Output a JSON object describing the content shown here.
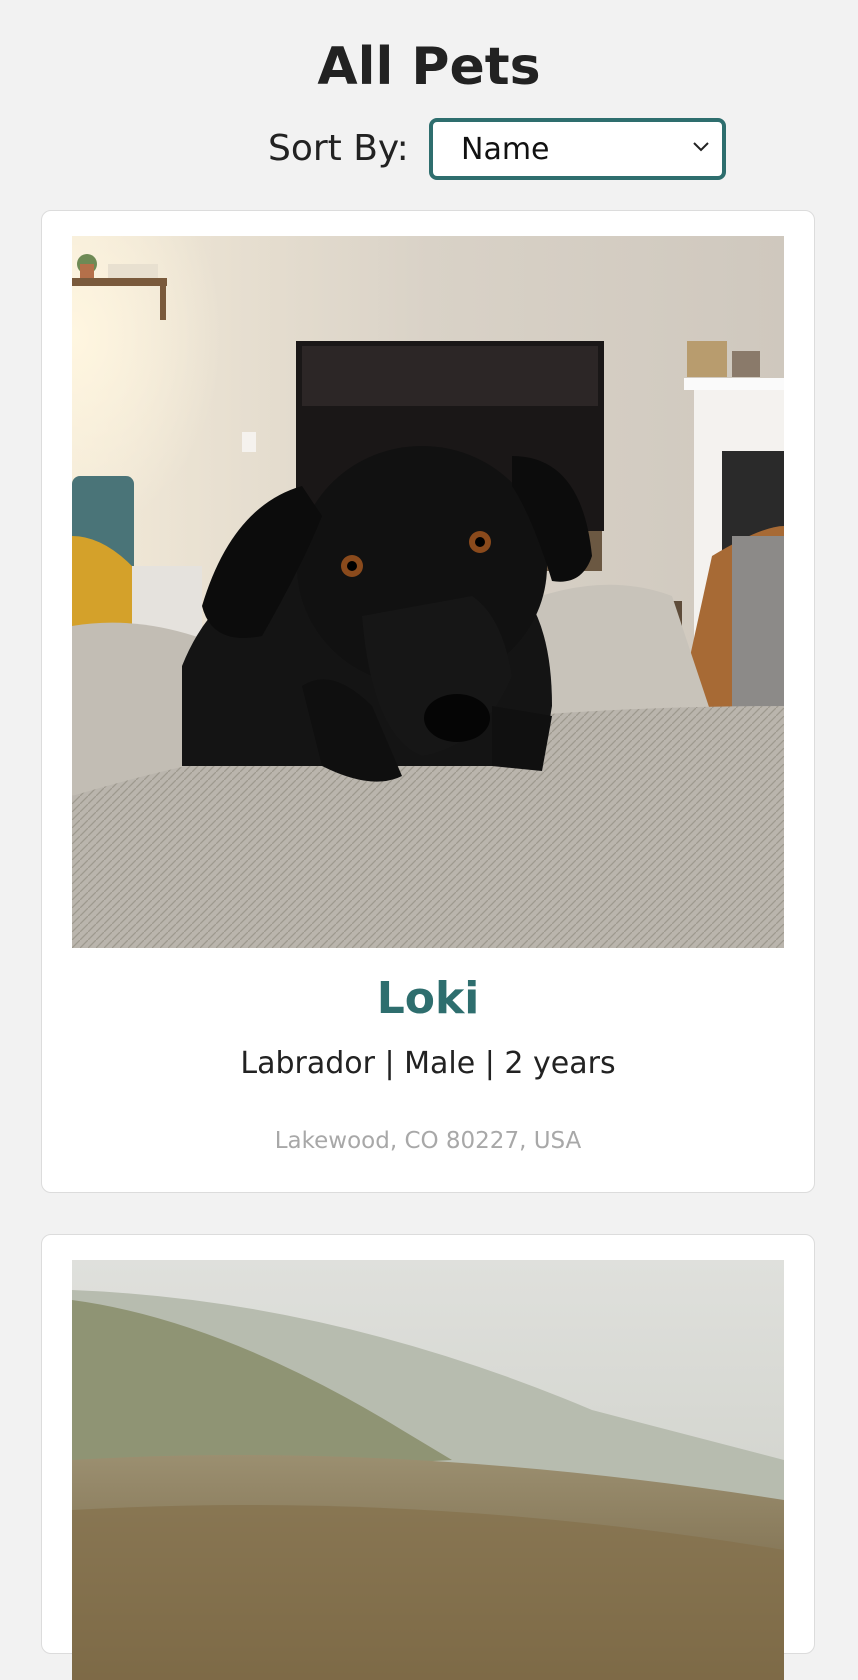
{
  "page": {
    "title": "All Pets"
  },
  "sort": {
    "label": "Sort By:",
    "selected": "Name"
  },
  "pets": [
    {
      "name": "Loki",
      "details": "Labrador | Male | 2 years",
      "location": "Lakewood, CO 80227, USA",
      "photo": "black-labrador-on-couch"
    },
    {
      "photo": "hillside-landscape"
    }
  ],
  "colors": {
    "accent": "#2e6e6e",
    "background": "#f2f2f2",
    "muted_text": "#a8a8a8"
  }
}
